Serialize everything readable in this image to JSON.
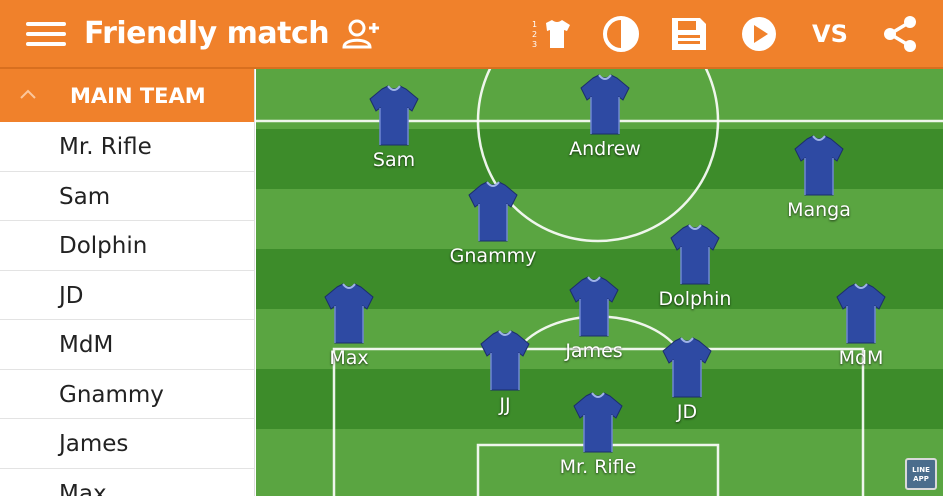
{
  "appbar": {
    "title": "Friendly match",
    "vs_label": "VS",
    "icons": [
      "menu-icon",
      "add-user-icon",
      "shirt-numbers-icon",
      "contrast-icon",
      "save-icon",
      "play-icon",
      "share-icon"
    ],
    "color": "#f0812b"
  },
  "sidebar": {
    "header": "MAIN TEAM",
    "items": [
      "Mr. Rifle",
      "Sam",
      "Dolphin",
      "JD",
      "MdM",
      "Gnammy",
      "James",
      "Max"
    ]
  },
  "field": {
    "players": [
      "Sam",
      "Andrew",
      "Manga",
      "Gnammy",
      "Dolphin",
      "Max",
      "James",
      "MdM",
      "JJ",
      "JD",
      "Mr. Rifle"
    ],
    "shirt_color": "#2e4aa3",
    "grass_dark": "#3d8c2a",
    "grass_light": "#5aa541",
    "badge_text": "LINE APP"
  }
}
